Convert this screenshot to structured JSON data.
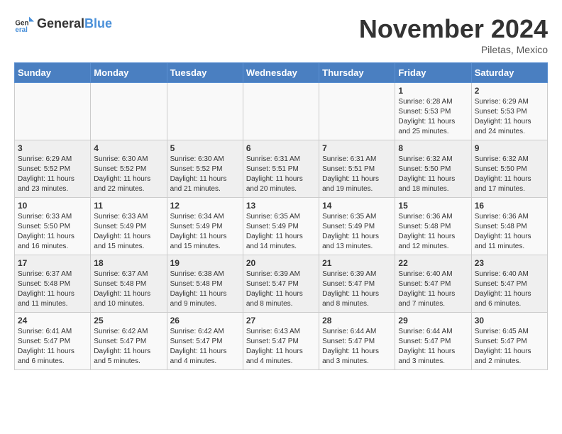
{
  "app": {
    "logo_general": "General",
    "logo_blue": "Blue",
    "month_title": "November 2024",
    "subtitle": "Piletas, Mexico"
  },
  "calendar": {
    "days_of_week": [
      "Sunday",
      "Monday",
      "Tuesday",
      "Wednesday",
      "Thursday",
      "Friday",
      "Saturday"
    ],
    "weeks": [
      [
        {
          "day": "",
          "info": ""
        },
        {
          "day": "",
          "info": ""
        },
        {
          "day": "",
          "info": ""
        },
        {
          "day": "",
          "info": ""
        },
        {
          "day": "",
          "info": ""
        },
        {
          "day": "1",
          "info": "Sunrise: 6:28 AM\nSunset: 5:53 PM\nDaylight: 11 hours and 25 minutes."
        },
        {
          "day": "2",
          "info": "Sunrise: 6:29 AM\nSunset: 5:53 PM\nDaylight: 11 hours and 24 minutes."
        }
      ],
      [
        {
          "day": "3",
          "info": "Sunrise: 6:29 AM\nSunset: 5:52 PM\nDaylight: 11 hours and 23 minutes."
        },
        {
          "day": "4",
          "info": "Sunrise: 6:30 AM\nSunset: 5:52 PM\nDaylight: 11 hours and 22 minutes."
        },
        {
          "day": "5",
          "info": "Sunrise: 6:30 AM\nSunset: 5:52 PM\nDaylight: 11 hours and 21 minutes."
        },
        {
          "day": "6",
          "info": "Sunrise: 6:31 AM\nSunset: 5:51 PM\nDaylight: 11 hours and 20 minutes."
        },
        {
          "day": "7",
          "info": "Sunrise: 6:31 AM\nSunset: 5:51 PM\nDaylight: 11 hours and 19 minutes."
        },
        {
          "day": "8",
          "info": "Sunrise: 6:32 AM\nSunset: 5:50 PM\nDaylight: 11 hours and 18 minutes."
        },
        {
          "day": "9",
          "info": "Sunrise: 6:32 AM\nSunset: 5:50 PM\nDaylight: 11 hours and 17 minutes."
        }
      ],
      [
        {
          "day": "10",
          "info": "Sunrise: 6:33 AM\nSunset: 5:50 PM\nDaylight: 11 hours and 16 minutes."
        },
        {
          "day": "11",
          "info": "Sunrise: 6:33 AM\nSunset: 5:49 PM\nDaylight: 11 hours and 15 minutes."
        },
        {
          "day": "12",
          "info": "Sunrise: 6:34 AM\nSunset: 5:49 PM\nDaylight: 11 hours and 15 minutes."
        },
        {
          "day": "13",
          "info": "Sunrise: 6:35 AM\nSunset: 5:49 PM\nDaylight: 11 hours and 14 minutes."
        },
        {
          "day": "14",
          "info": "Sunrise: 6:35 AM\nSunset: 5:49 PM\nDaylight: 11 hours and 13 minutes."
        },
        {
          "day": "15",
          "info": "Sunrise: 6:36 AM\nSunset: 5:48 PM\nDaylight: 11 hours and 12 minutes."
        },
        {
          "day": "16",
          "info": "Sunrise: 6:36 AM\nSunset: 5:48 PM\nDaylight: 11 hours and 11 minutes."
        }
      ],
      [
        {
          "day": "17",
          "info": "Sunrise: 6:37 AM\nSunset: 5:48 PM\nDaylight: 11 hours and 11 minutes."
        },
        {
          "day": "18",
          "info": "Sunrise: 6:37 AM\nSunset: 5:48 PM\nDaylight: 11 hours and 10 minutes."
        },
        {
          "day": "19",
          "info": "Sunrise: 6:38 AM\nSunset: 5:48 PM\nDaylight: 11 hours and 9 minutes."
        },
        {
          "day": "20",
          "info": "Sunrise: 6:39 AM\nSunset: 5:47 PM\nDaylight: 11 hours and 8 minutes."
        },
        {
          "day": "21",
          "info": "Sunrise: 6:39 AM\nSunset: 5:47 PM\nDaylight: 11 hours and 8 minutes."
        },
        {
          "day": "22",
          "info": "Sunrise: 6:40 AM\nSunset: 5:47 PM\nDaylight: 11 hours and 7 minutes."
        },
        {
          "day": "23",
          "info": "Sunrise: 6:40 AM\nSunset: 5:47 PM\nDaylight: 11 hours and 6 minutes."
        }
      ],
      [
        {
          "day": "24",
          "info": "Sunrise: 6:41 AM\nSunset: 5:47 PM\nDaylight: 11 hours and 6 minutes."
        },
        {
          "day": "25",
          "info": "Sunrise: 6:42 AM\nSunset: 5:47 PM\nDaylight: 11 hours and 5 minutes."
        },
        {
          "day": "26",
          "info": "Sunrise: 6:42 AM\nSunset: 5:47 PM\nDaylight: 11 hours and 4 minutes."
        },
        {
          "day": "27",
          "info": "Sunrise: 6:43 AM\nSunset: 5:47 PM\nDaylight: 11 hours and 4 minutes."
        },
        {
          "day": "28",
          "info": "Sunrise: 6:44 AM\nSunset: 5:47 PM\nDaylight: 11 hours and 3 minutes."
        },
        {
          "day": "29",
          "info": "Sunrise: 6:44 AM\nSunset: 5:47 PM\nDaylight: 11 hours and 3 minutes."
        },
        {
          "day": "30",
          "info": "Sunrise: 6:45 AM\nSunset: 5:47 PM\nDaylight: 11 hours and 2 minutes."
        }
      ]
    ]
  }
}
